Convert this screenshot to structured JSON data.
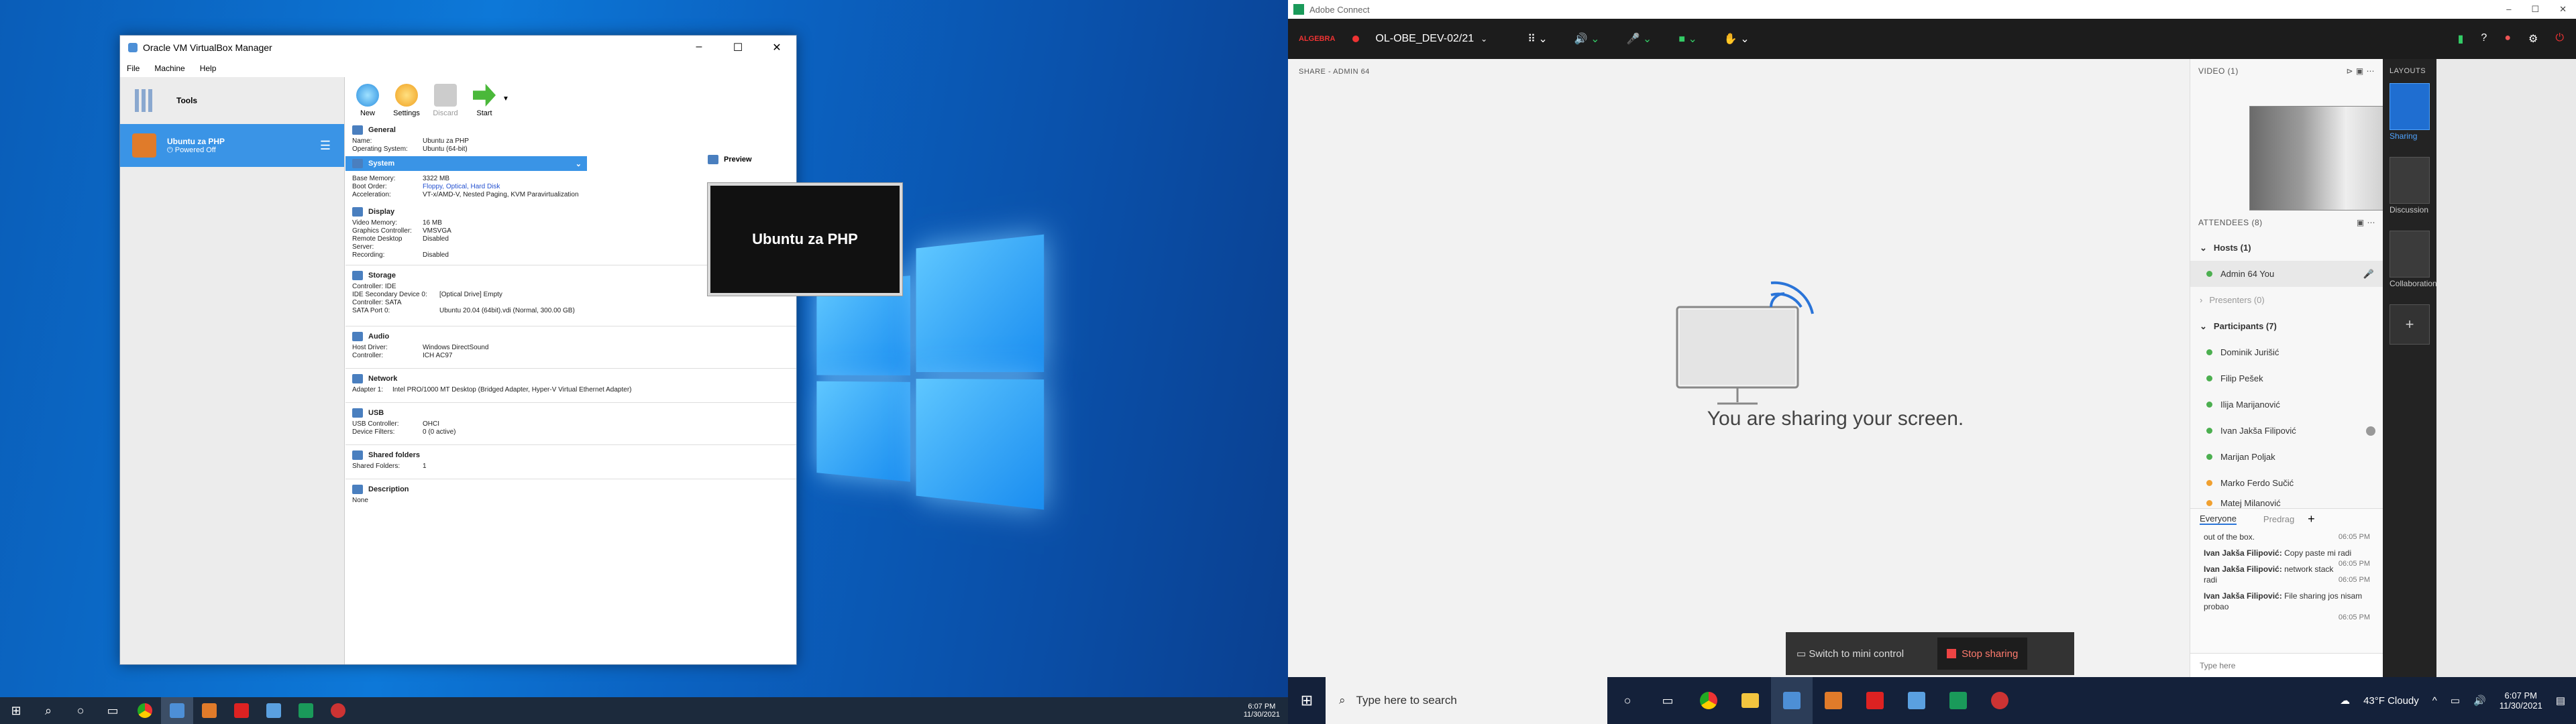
{
  "virtualbox": {
    "title": "Oracle VM VirtualBox Manager",
    "menu": [
      "File",
      "Machine",
      "Help"
    ],
    "tools_label": "Tools",
    "vm": {
      "name": "Ubuntu za PHP",
      "state": "Powered Off"
    },
    "toolbar": [
      "New",
      "Settings",
      "Discard",
      "Start"
    ],
    "general": {
      "title": "General",
      "rows": [
        [
          "Name:",
          "Ubuntu za PHP"
        ],
        [
          "Operating System:",
          "Ubuntu (64-bit)"
        ]
      ]
    },
    "system": {
      "title": "System",
      "rows": [
        [
          "Base Memory:",
          "3322 MB"
        ],
        [
          "Boot Order:",
          "Floppy, Optical, Hard Disk"
        ],
        [
          "Acceleration:",
          "VT-x/AMD-V, Nested Paging, KVM Paravirtualization"
        ]
      ]
    },
    "display": {
      "title": "Display",
      "rows": [
        [
          "Video Memory:",
          "16 MB"
        ],
        [
          "Graphics Controller:",
          "VMSVGA"
        ],
        [
          "Remote Desktop Server:",
          "Disabled"
        ],
        [
          "Recording:",
          "Disabled"
        ]
      ]
    },
    "storage": {
      "title": "Storage",
      "rows": [
        [
          "Controller: IDE",
          ""
        ],
        [
          " IDE Secondary Device 0:",
          "[Optical Drive] Empty"
        ],
        [
          "Controller: SATA",
          ""
        ],
        [
          " SATA Port 0:",
          "Ubuntu 20.04 (64bit).vdi (Normal, 300.00 GB)"
        ]
      ]
    },
    "audio": {
      "title": "Audio",
      "rows": [
        [
          "Host Driver:",
          "Windows DirectSound"
        ],
        [
          "Controller:",
          "ICH AC97"
        ]
      ]
    },
    "network": {
      "title": "Network",
      "rows": [
        [
          "Adapter 1:",
          "Intel PRO/1000 MT Desktop (Bridged Adapter, Hyper-V Virtual Ethernet Adapter)"
        ]
      ]
    },
    "usb": {
      "title": "USB",
      "rows": [
        [
          "USB Controller:",
          "OHCI"
        ],
        [
          "Device Filters:",
          "0 (0 active)"
        ]
      ]
    },
    "shared": {
      "title": "Shared folders",
      "rows": [
        [
          "Shared Folders:",
          "1"
        ]
      ]
    },
    "description": {
      "title": "Description",
      "text": "None"
    },
    "preview": {
      "title": "Preview",
      "screen_text": "Ubuntu za PHP"
    }
  },
  "left_taskbar": {
    "time": "6:07 PM",
    "date": "11/30/2021"
  },
  "connect": {
    "window_title": "Adobe Connect",
    "brand": "ALGEBRA",
    "room": "OL-OBE_DEV-02/21",
    "share_header": "SHARE - ADMIN 64",
    "share_message": "You are sharing your screen.",
    "mini_control": "Switch to mini control",
    "stop_sharing": "Stop sharing",
    "video_header": "VIDEO (1)",
    "attendees_header": "ATTENDEES (8)",
    "hosts": "Hosts (1)",
    "host_name": "Admin 64 You",
    "presenters": "Presenters (0)",
    "participants_header": "Participants (7)",
    "participants": [
      "Dominik Jurišić",
      "Filip Pešek",
      "Ilija Marijanović",
      "Ivan Jakša Filipović",
      "Marijan Poljak",
      "Marko Ferdo Sučić",
      "Matej Milanović"
    ],
    "chat_tabs": [
      "Everyone",
      "Predrag"
    ],
    "chat": [
      {
        "from": "",
        "text": "out of the box.",
        "time": "06:05 PM"
      },
      {
        "from": "Ivan Jakša Filipović:",
        "text": "Copy paste mi radi",
        "time": "06:05 PM"
      },
      {
        "from": "Ivan Jakša Filipović:",
        "text": "network stack radi",
        "time": "06:05 PM"
      },
      {
        "from": "Ivan Jakša Filipović:",
        "text": "File sharing jos nisam probao",
        "time": "06:05 PM"
      }
    ],
    "chat_placeholder": "Type here",
    "layouts_header": "LAYOUTS",
    "layouts": [
      "Sharing",
      "Discussion",
      "Collaboration"
    ]
  },
  "right_taskbar": {
    "search_placeholder": "Type here to search",
    "weather": "43°F Cloudy",
    "time": "6:07 PM",
    "date": "11/30/2021"
  }
}
